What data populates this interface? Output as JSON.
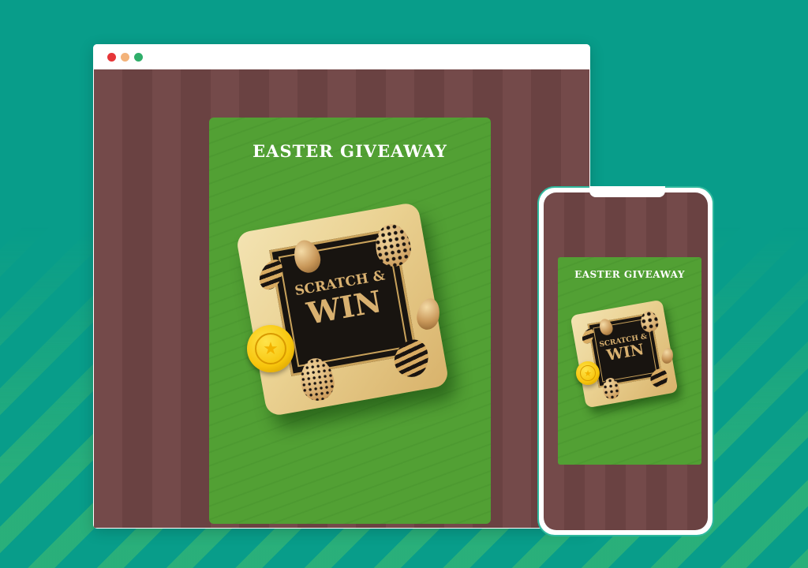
{
  "desktop": {
    "window_controls": [
      "close",
      "minimize",
      "maximize"
    ],
    "card": {
      "title": "EASTER GIVEAWAY",
      "graphic": {
        "line1": "SCRATCH &",
        "line2": "WIN"
      }
    }
  },
  "mobile": {
    "card": {
      "title": "EASTER GIVEAWAY",
      "graphic": {
        "line1": "SCRATCH &",
        "line2": "WIN"
      }
    }
  },
  "colors": {
    "page_bg": "#089d8a",
    "card_green": "#52a034",
    "stripe_brown": "#744a4a",
    "gold": "#c9a25b"
  },
  "icons": [
    "star-icon"
  ]
}
